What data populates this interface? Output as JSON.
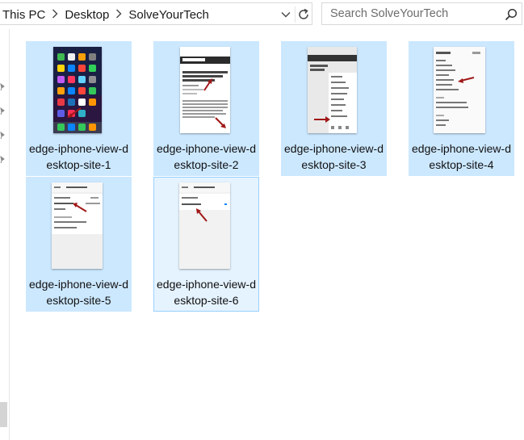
{
  "address_bar": {
    "breadcrumbs": [
      "This PC",
      "Desktop",
      "SolveYourTech"
    ],
    "separator_icon": "chevron-right-icon",
    "dropdown_icon": "chevron-down-icon",
    "refresh_icon": "refresh-icon"
  },
  "search": {
    "placeholder": "Search SolveYourTech",
    "icon": "search-icon"
  },
  "nav": {
    "pin_icon": "pin-icon"
  },
  "files": [
    {
      "name": "edge-iphone-view-desktop-site-1",
      "thumb": "home-screen"
    },
    {
      "name": "edge-iphone-view-desktop-site-2",
      "thumb": "webpage"
    },
    {
      "name": "edge-iphone-view-desktop-site-3",
      "thumb": "menu"
    },
    {
      "name": "edge-iphone-view-desktop-site-4",
      "thumb": "settings"
    },
    {
      "name": "edge-iphone-view-desktop-site-5",
      "thumb": "advanced"
    },
    {
      "name": "edge-iphone-view-desktop-site-6",
      "thumb": "display"
    }
  ],
  "colors": {
    "selection": "#cce8ff",
    "focus_border": "#99d1ff",
    "arrow": "#a01818"
  }
}
